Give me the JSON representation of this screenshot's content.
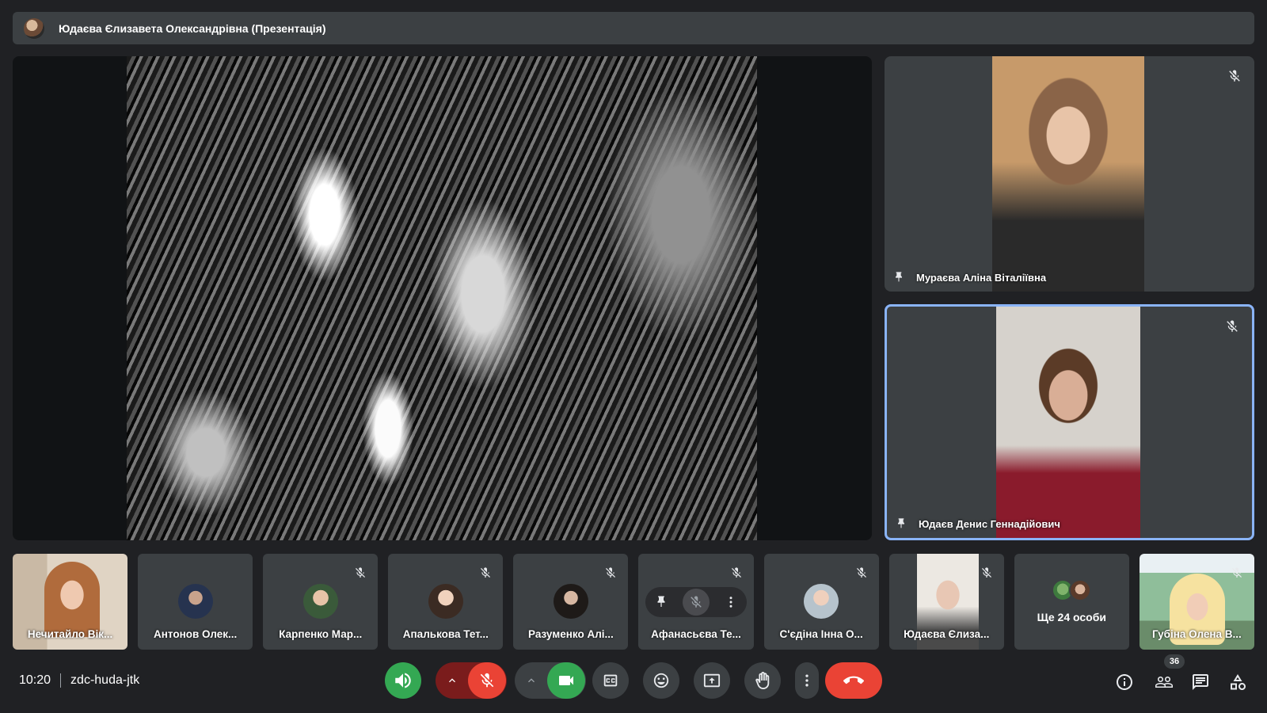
{
  "presentation": {
    "title": "Юдаєва Єлизавета Олександрівна (Презентація)"
  },
  "pinned_tiles": [
    {
      "name": "Мураєва Аліна Віталіївна"
    },
    {
      "name": "Юдаєв Денис Геннадійович"
    }
  ],
  "participants": [
    {
      "name": "Нечитайло Вік..."
    },
    {
      "name": "Антонов Олек..."
    },
    {
      "name": "Карпенко Мар..."
    },
    {
      "name": "Апалькова Тет..."
    },
    {
      "name": "Разуменко Алі..."
    },
    {
      "name": "Афанасьєва Те..."
    },
    {
      "name": "С'єдіна Інна О..."
    },
    {
      "name": "Юдаєва Єлиза..."
    },
    {
      "name": "Губіна Олена В..."
    }
  ],
  "more_people": {
    "label": "Ще 24 особи"
  },
  "footer": {
    "time": "10:20",
    "meeting_code": "zdc-huda-jtk",
    "participant_count": "36"
  },
  "colors": {
    "background": "#202124",
    "tile": "#3c4043",
    "active_border": "#8ab4f8",
    "green": "#34a853",
    "red": "#ea4335",
    "dark_red": "#7a1c1c"
  },
  "icons": {
    "speaker": "speaker-icon",
    "mic_off": "mic-off-icon",
    "camera": "camera-icon",
    "captions": "captions-icon",
    "emoji": "emoji-icon",
    "present": "present-icon",
    "hand": "raise-hand-icon",
    "more": "more-vert-icon",
    "hangup": "hangup-icon",
    "info": "info-icon",
    "people": "people-icon",
    "chat": "chat-icon",
    "activities": "activities-icon",
    "pin": "pin-icon"
  }
}
